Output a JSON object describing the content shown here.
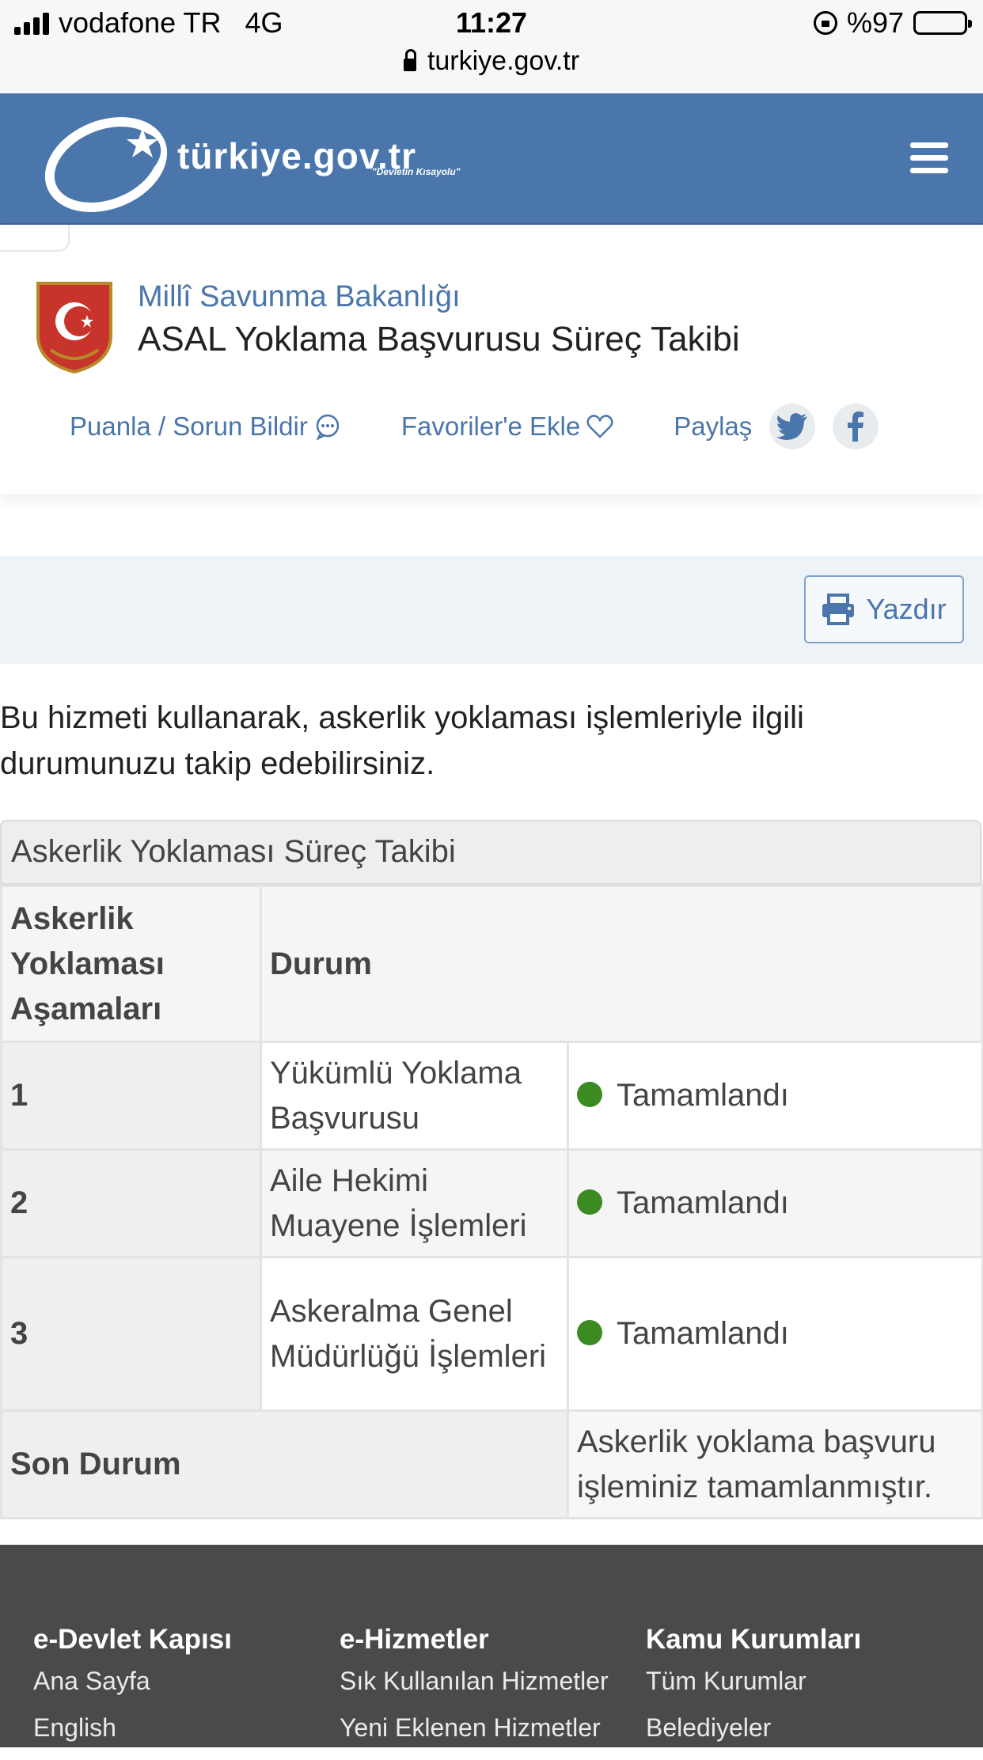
{
  "status_bar": {
    "carrier": "vodafone TR",
    "network": "4G",
    "time": "11:27",
    "battery": "%97",
    "url": "turkiye.gov.tr"
  },
  "header": {
    "logo_text": "türkiye.gov.tr",
    "logo_tagline": "\"Devletin Kısayolu\""
  },
  "service": {
    "ministry": "Millî Savunma Bakanlığı",
    "title": "ASAL Yoklama Başvurusu Süreç Takibi",
    "rate_label": "Puanla / Sorun Bildir",
    "favorite_label": "Favoriler'e Ekle",
    "share_label": "Paylaş"
  },
  "toolbar": {
    "print_label": "Yazdır"
  },
  "intro": "Bu hizmeti kullanarak, askerlik yoklaması işlemleriyle ilgili durumunuzu takip edebilirsiniz.",
  "table": {
    "caption": "Askerlik Yoklaması Süreç Takibi",
    "header_col1": "Askerlik Yoklaması Aşamaları",
    "header_col2": "Durum",
    "rows": [
      {
        "no": "1",
        "step": "Yükümlü Yoklama Başvurusu",
        "status": "Tamamlandı"
      },
      {
        "no": "2",
        "step": "Aile Hekimi Muayene İşlemleri",
        "status": "Tamamlandı"
      },
      {
        "no": "3",
        "step": "Askeralma Genel Müdürlüğü İşlemleri",
        "status": "Tamamlandı"
      }
    ],
    "final_label": "Son Durum",
    "final_value": "Askerlik yoklama başvuru işleminiz tamamlanmıştır.",
    "status_color": "#3b8a22"
  },
  "footer": {
    "columns": [
      {
        "title": "e-Devlet Kapısı",
        "links": [
          "Ana Sayfa",
          "English"
        ]
      },
      {
        "title": "e-Hizmetler",
        "links": [
          "Sık Kullanılan Hizmetler",
          "Yeni Eklenen Hizmetler"
        ]
      },
      {
        "title": "Kamu Kurumları",
        "links": [
          "Tüm Kurumlar",
          "Belediyeler"
        ]
      }
    ]
  },
  "colors": {
    "brand_blue": "#4a76ab",
    "footer_bg": "#494a4b",
    "band_bg": "#eef3f8"
  }
}
